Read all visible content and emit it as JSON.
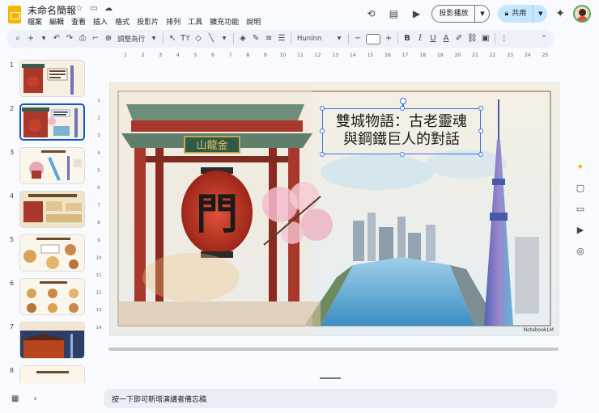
{
  "app": {
    "doc_title": "未命名簡報",
    "menu": [
      "檔案",
      "編輯",
      "查看",
      "插入",
      "格式",
      "投影片",
      "排列",
      "工具",
      "擴充功能",
      "說明"
    ],
    "present_label": "投影播放",
    "share_label": "共用"
  },
  "toolbar": {
    "fit_label": "調整為行",
    "font_name": "Huninn"
  },
  "ruler_top_labels": [
    "1",
    "2",
    "3",
    "4",
    "5",
    "6",
    "7",
    "8",
    "9",
    "10",
    "11",
    "12",
    "13",
    "14",
    "15",
    "16",
    "17",
    "18",
    "19",
    "20",
    "21",
    "22",
    "23",
    "24",
    "25"
  ],
  "ruler_left_labels": [
    "1",
    "2",
    "3",
    "4",
    "5",
    "6",
    "7",
    "8",
    "9",
    "10",
    "11",
    "12",
    "13",
    "14"
  ],
  "filmstrip": [
    {
      "num": "1",
      "title": "雙城物語：古老靈魂與鋼鐵巨人的對話"
    },
    {
      "num": "2",
      "title": "雙城物語：古老靈魂與鋼鐵巨人的對話"
    },
    {
      "num": "3",
      "title": "探索時空交錯"
    },
    {
      "num": "4",
      "title": "踏入1400年歷史的淺草"
    },
    {
      "num": "5",
      "title": "仲見世通：舌尖上的江戶"
    },
    {
      "num": "6",
      "title": "舌尖上的江戶記憶"
    },
    {
      "num": "7",
      "title": "淺草寺與晴空塔的夜景"
    },
    {
      "num": "8",
      "title": "KM時代的新發現"
    }
  ],
  "slide": {
    "title_line1": "雙城物語：古老靈魂",
    "title_line2": "與鋼鐵巨人的對話",
    "gate_plaque": "山龍金",
    "lantern_char": "門",
    "watermark": "NotebookLM"
  },
  "notes_placeholder": "按一下即可新增演講者備忘稿"
}
